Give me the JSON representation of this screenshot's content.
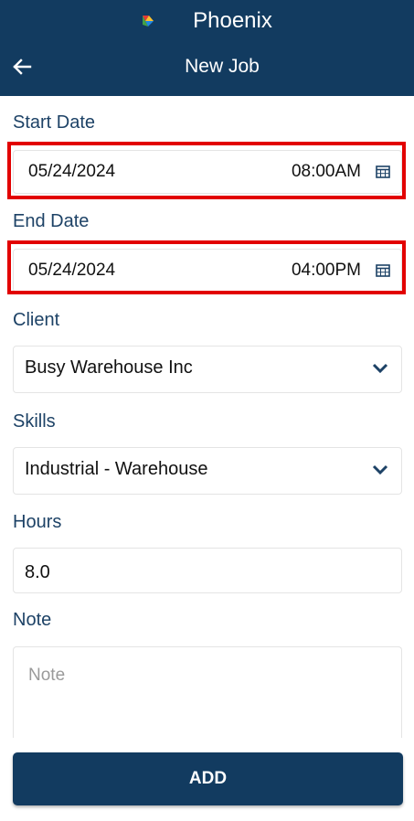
{
  "appbar": {
    "app_name": "Phoenix",
    "page_title": "New Job",
    "colors": {
      "bar": "#123b60"
    }
  },
  "form": {
    "start_date": {
      "label": "Start Date",
      "date": "05/24/2024",
      "time": "08:00AM"
    },
    "end_date": {
      "label": "End Date",
      "date": "05/24/2024",
      "time": "04:00PM"
    },
    "client": {
      "label": "Client",
      "value": "Busy Warehouse Inc"
    },
    "skills": {
      "label": "Skills",
      "value": "Industrial - Warehouse"
    },
    "hours": {
      "label": "Hours",
      "value": "8.0"
    },
    "note": {
      "label": "Note",
      "placeholder": "Note"
    }
  },
  "actions": {
    "add_label": "ADD"
  },
  "highlight_color": "#e20000"
}
